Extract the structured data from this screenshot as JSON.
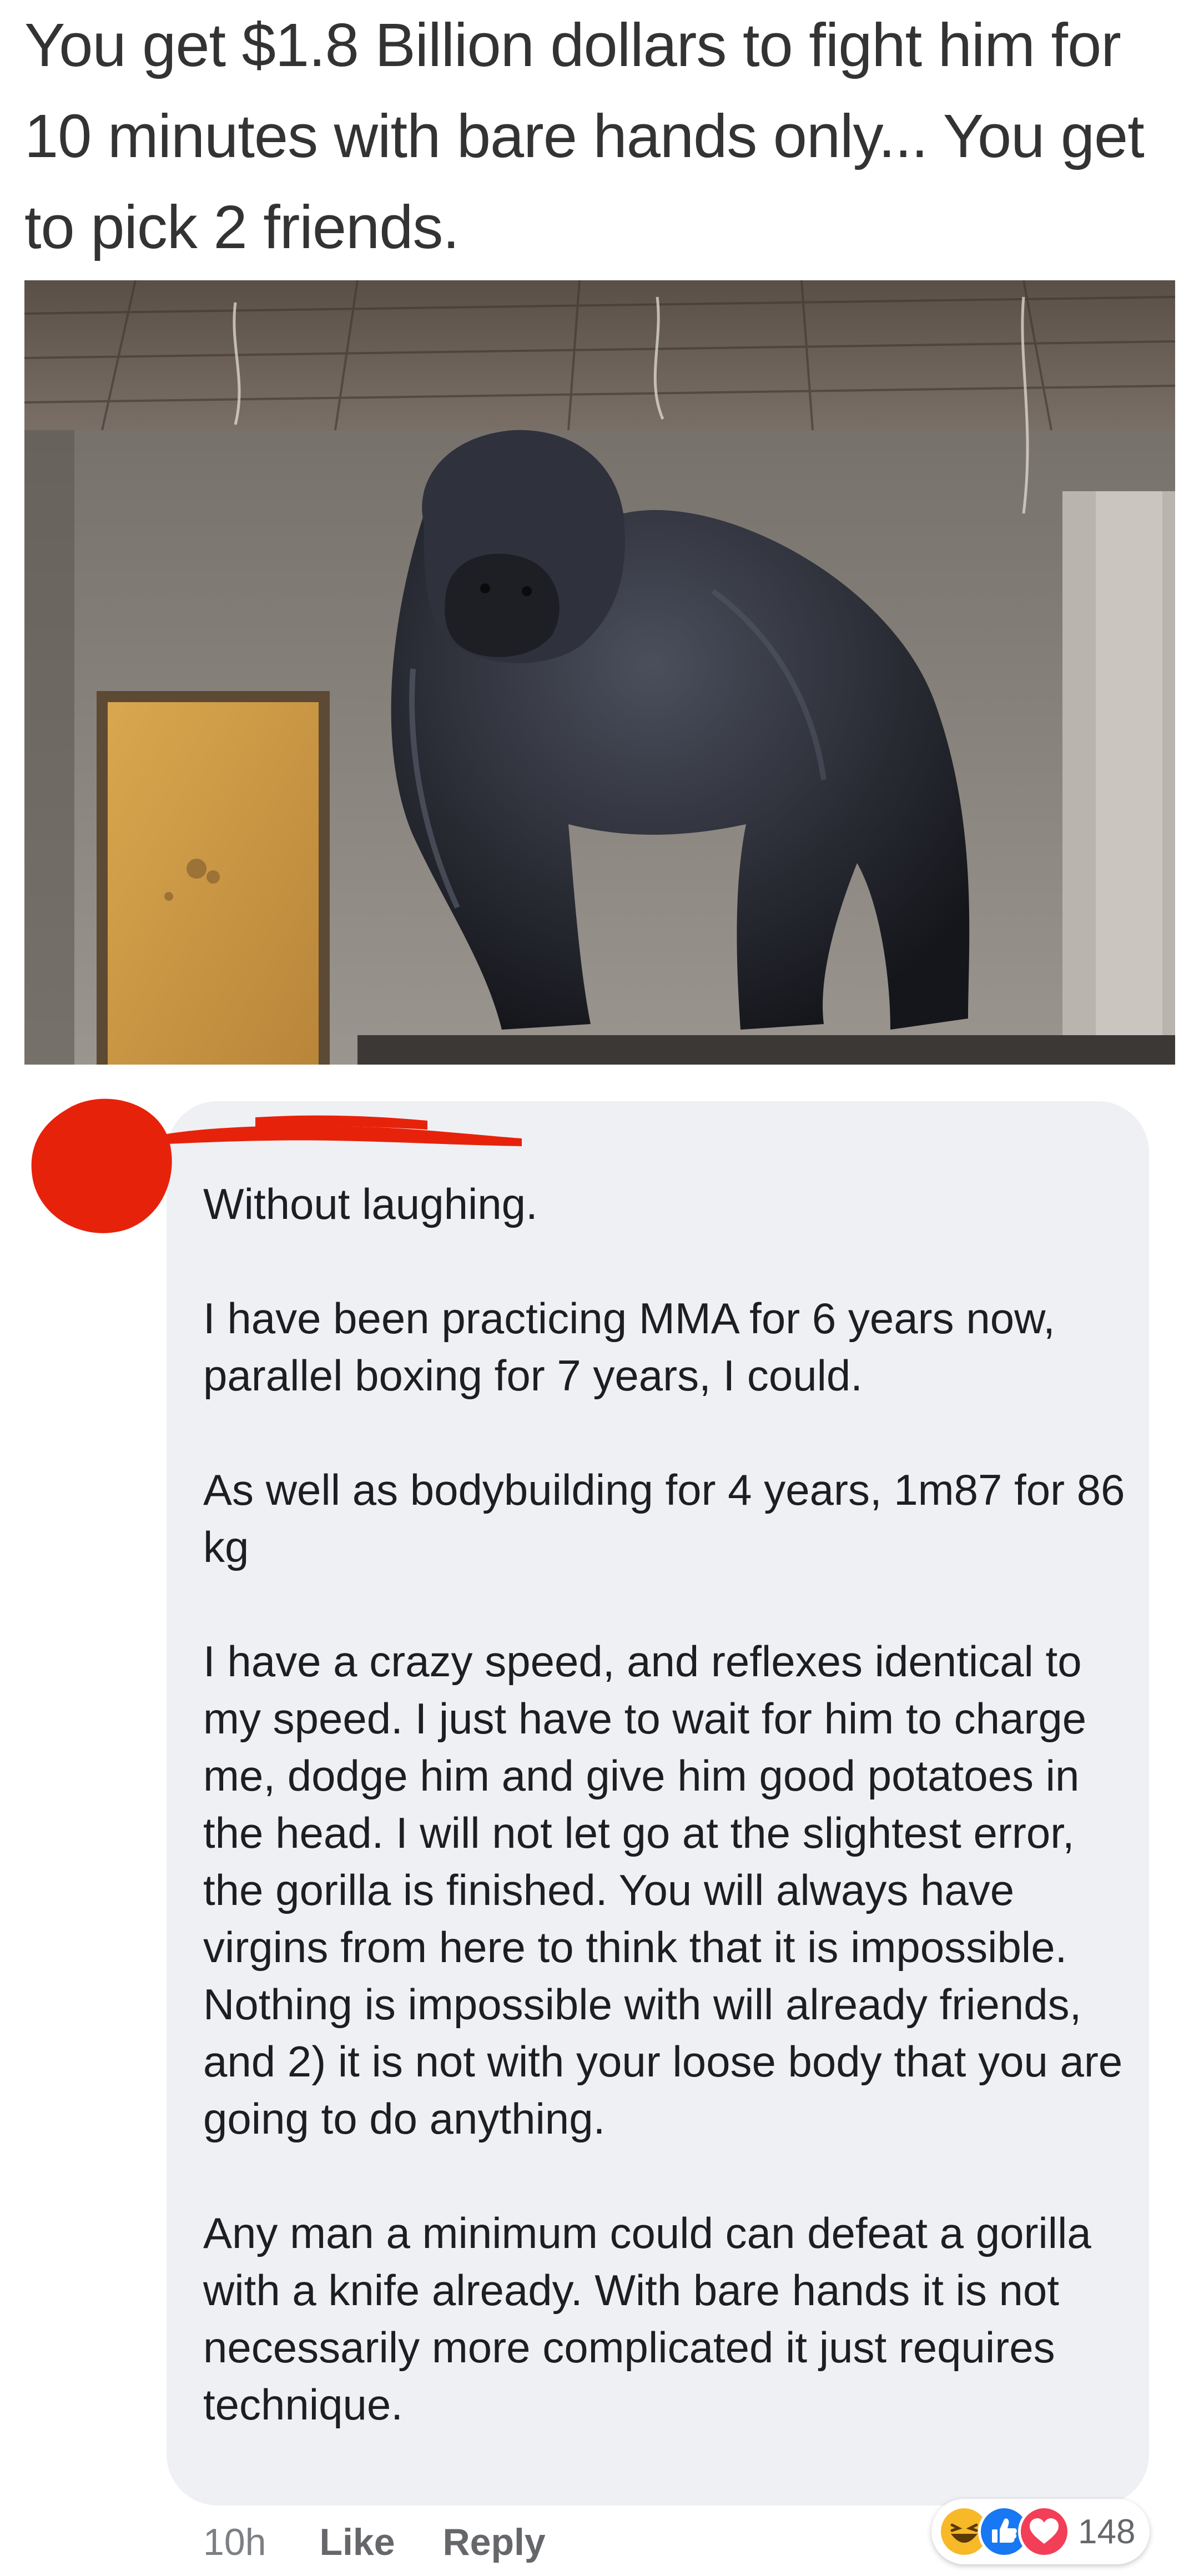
{
  "post": {
    "caption_lines": [
      "You get $1.8 Billion dollars to fight him for",
      "10 minutes with bare hands only... You get",
      "to pick 2 friends."
    ]
  },
  "comment": {
    "paragraphs": [
      "Without laughing.",
      "I have been practicing MMA for 6 years now, parallel boxing for 7 years, I could.",
      "As well as bodybuilding for 4 years, 1m87 for 86 kg",
      "I have a crazy speed, and reflexes identical to my speed. I just have to wait for him to charge me, dodge him and give him good potatoes in the head. I will not let go at the slightest error, the gorilla is finished. You will always have virgins from here to think that it is impossible. Nothing is impossible with will already friends, and 2) it is not with your loose body that you are going to do anything.",
      "Any man a minimum could can defeat a gorilla with a knife already. With bare hands it is not necessarily more complicated it just requires technique."
    ],
    "timestamp": "10h",
    "like_label": "Like",
    "reply_label": "Reply",
    "reactions": {
      "icons": [
        "laughing-face-icon",
        "thumbs-up-icon",
        "heart-icon"
      ],
      "count": "148"
    }
  },
  "colors": {
    "bubble_bg": "#eff0f4",
    "redaction": "#e7220b",
    "like_blue": "#1877f2",
    "love_red": "#f33e58",
    "haha_yellow": "#f7b928"
  }
}
